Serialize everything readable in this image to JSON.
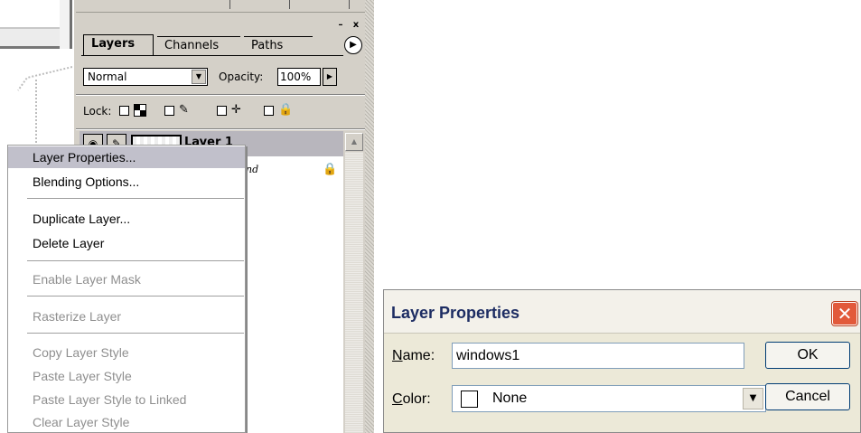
{
  "palette": {
    "tabs": [
      "Layers",
      "Channels",
      "Paths"
    ],
    "blend_mode": "Normal",
    "opacity_label": "Opacity:",
    "opacity_value": "100%",
    "lock_label": "Lock:",
    "layer_name": "Layer 1",
    "background_fragment": "nd"
  },
  "context_menu": {
    "items": [
      "Layer Properties...",
      "Blending Options...",
      "Duplicate Layer...",
      "Delete Layer",
      "Enable Layer Mask",
      "Rasterize Layer",
      "Copy Layer Style",
      "Paste Layer Style",
      "Paste Layer Style to Linked",
      "Clear Layer Style"
    ],
    "highlighted": "Layer Properties...",
    "disabled": [
      "Enable Layer Mask",
      "Rasterize Layer",
      "Copy Layer Style",
      "Paste Layer Style",
      "Paste Layer Style to Linked",
      "Clear Layer Style"
    ]
  },
  "dialog": {
    "title": "Layer Properties",
    "name_label_access": "N",
    "name_label_rest": "ame:",
    "name_value": "windows1",
    "color_label_access": "C",
    "color_label_rest": "olor:",
    "color_value": "None",
    "ok_label": "OK",
    "cancel_label": "Cancel"
  },
  "icons": {
    "close": "close-icon",
    "eye": "eye-icon",
    "brush": "brush-icon",
    "lock": "lock-icon",
    "move": "move-icon",
    "palette_menu": "palette-menu-arrow-icon"
  },
  "colors": {
    "dialog_title_text": "#1d2d63",
    "close_button": "#e25a3b",
    "menu_highlight": "#c1c0cb",
    "palette_face": "#d4d0c8"
  }
}
